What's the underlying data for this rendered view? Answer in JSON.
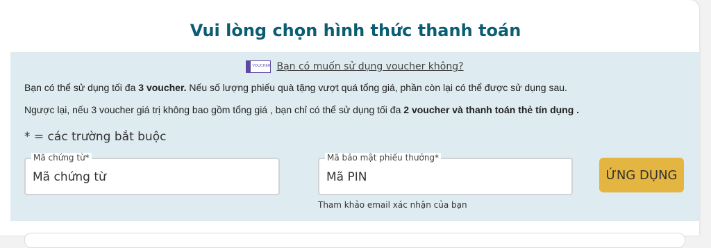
{
  "header": {
    "title": "Vui lòng chọn hình thức thanh toán"
  },
  "voucher": {
    "icon_text": "VOUCHER",
    "question": "Bạn có muốn sử dụng voucher không?"
  },
  "info": {
    "line1_a": "Bạn có thể sử dụng tối đa ",
    "line1_b": "3 voucher.",
    "line1_c": " Nếu số lượng phiếu quà tặng vượt quá tổng giá, phần còn lại có thể được sử dụng sau.",
    "line2_a": "Ngược lại, nếu 3 voucher giá trị không bao gồm tổng giá , bạn chỉ có thể sử dụng tối đa ",
    "line2_b": "2 voucher và thanh toán thẻ tín dụng ."
  },
  "form": {
    "required_note": "* = các trường bắt buộc",
    "voucher_code_label": "Mã chứng từ*",
    "voucher_code_placeholder": "Mã chứng từ",
    "pin_label": "Mã bảo mật phiếu thưởng*",
    "pin_placeholder": "Mã PIN",
    "pin_helper": "Tham khảo email xác nhận của bạn",
    "apply_label": "ỨNG DỤNG"
  },
  "colors": {
    "title": "#0b5d73",
    "panel_bg": "#deebf0",
    "apply_button": "#e5b541",
    "voucher_icon": "#5b4aa0"
  }
}
